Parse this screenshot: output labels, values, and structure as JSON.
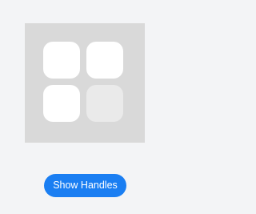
{
  "grid": {
    "tiles": [
      {
        "id": 1,
        "state": "normal"
      },
      {
        "id": 2,
        "state": "normal"
      },
      {
        "id": 3,
        "state": "normal"
      },
      {
        "id": 4,
        "state": "dimmed"
      }
    ]
  },
  "actions": {
    "show_handles_label": "Show Handles"
  },
  "colors": {
    "background": "#f3f4f6",
    "panel": "#d9d9d9",
    "tile": "#ffffff",
    "tile_dimmed": "#eaeaea",
    "accent": "#1a7ef2"
  }
}
